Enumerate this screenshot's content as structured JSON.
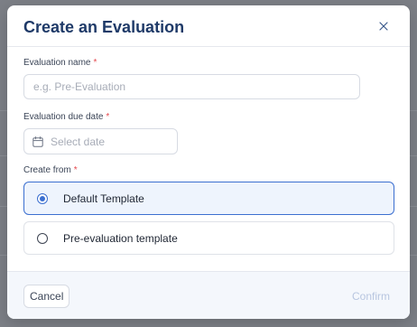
{
  "modal": {
    "title": "Create an Evaluation"
  },
  "fields": {
    "name": {
      "label": "Evaluation name",
      "required_mark": "*",
      "value": "",
      "placeholder": "e.g. Pre-Evaluation"
    },
    "due_date": {
      "label": "Evaluation due date",
      "required_mark": "*",
      "placeholder": "Select date",
      "icon": "calendar-icon"
    },
    "create_from": {
      "label": "Create from",
      "required_mark": "*",
      "options": [
        {
          "label": "Default Template",
          "selected": true
        },
        {
          "label": "Pre-evaluation template",
          "selected": false
        }
      ]
    }
  },
  "footer": {
    "cancel_label": "Cancel",
    "confirm_label": "Confirm",
    "confirm_disabled": true
  },
  "icons": {
    "close": "close-icon"
  },
  "colors": {
    "title": "#1f3a68",
    "accent": "#3b6fd0",
    "selected_bg": "#eef4fd",
    "required": "#e5484d",
    "disabled_text": "#b8c6e0"
  }
}
